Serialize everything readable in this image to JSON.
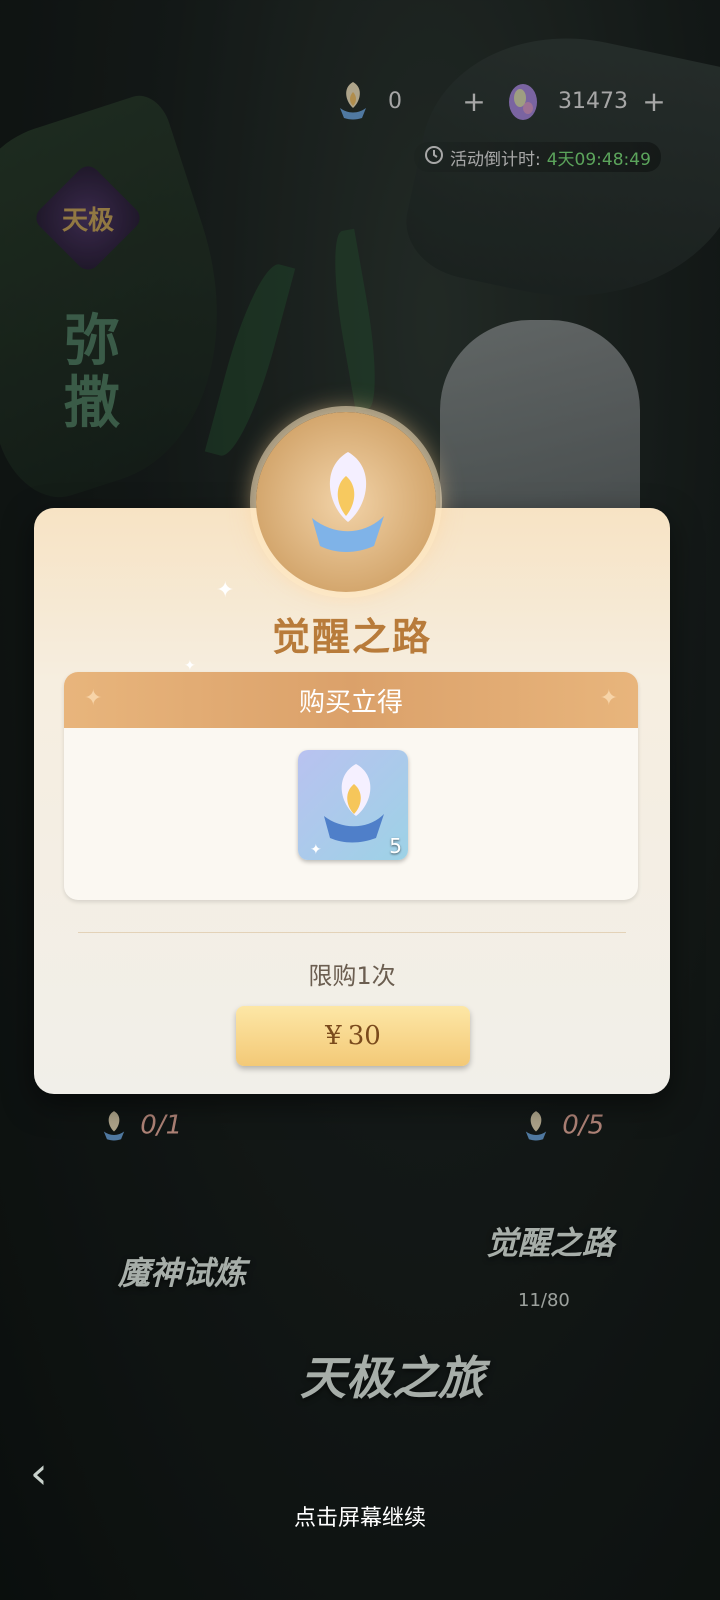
{
  "hud": {
    "resource1_value": "0",
    "resource2_value": "31473",
    "plus": "+",
    "timer_label": "活动倒计时:",
    "timer_value": "4天09:48:49"
  },
  "left_badge": "天极",
  "side_title": "弥撒",
  "modal": {
    "title": "觉醒之路",
    "panel_header": "购买立得",
    "item_count": "5",
    "limit_text": "限购1次",
    "price_currency": "¥",
    "price_value": "30"
  },
  "background": {
    "counter_left": "0/1",
    "counter_right": "0/5",
    "awaken_road": "觉醒之路",
    "progress": "11/80",
    "trial": "魔神试炼",
    "journey": "天极之旅"
  },
  "footer": {
    "continue_text": "点击屏幕继续"
  },
  "colors": {
    "timer_green": "#7fe37f",
    "title_gold": "#b87b3a",
    "panel_header": "#dba16a",
    "button_top": "#fde7a6",
    "button_bottom": "#f3c977",
    "counter_red": "#e45b4e"
  }
}
